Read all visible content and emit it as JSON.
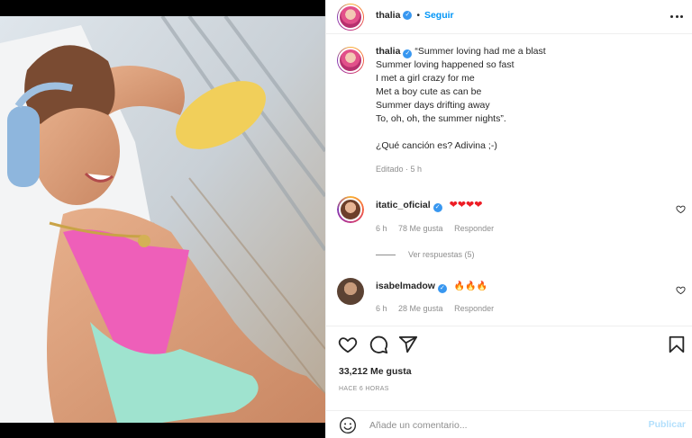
{
  "post_author": {
    "username": "thalia",
    "follow_label": "Seguir",
    "separator": "•"
  },
  "caption": {
    "lines": [
      "“Summer loving had me a blast",
      "Summer loving happened so fast",
      "I met a girl crazy for me",
      "Met a boy cute as can be",
      "Summer days drifting away",
      "To, oh, oh, the summer nights”.",
      "",
      "¿Qué canción es? Adivina ;-)"
    ],
    "edited": "Editado · 5 h"
  },
  "comments": [
    {
      "username": "itatic_oficial",
      "text": "❤❤❤❤",
      "time": "6 h",
      "likes": "78 Me gusta",
      "reply_label": "Responder",
      "view_replies": "Ver respuestas (5)"
    },
    {
      "username": "isabelmadow",
      "text": "🔥🔥🔥",
      "time": "6 h",
      "likes": "28 Me gusta",
      "reply_label": "Responder"
    }
  ],
  "post_stats": {
    "likes": "33,212 Me gusta",
    "time_ago": "HACE 6 HORAS"
  },
  "comment_input": {
    "placeholder": "Añade un comentario...",
    "publish_label": "Publicar"
  },
  "colors": {
    "accent_blue": "#0095f6",
    "publish_disabled": "#b2dffc",
    "muted_text": "#8e8e8e",
    "heart_red": "#ed1c24"
  },
  "icons": [
    "more-options-icon",
    "verified-badge-icon",
    "heart-icon",
    "comment-icon",
    "share-icon",
    "bookmark-icon",
    "emoji-icon"
  ]
}
